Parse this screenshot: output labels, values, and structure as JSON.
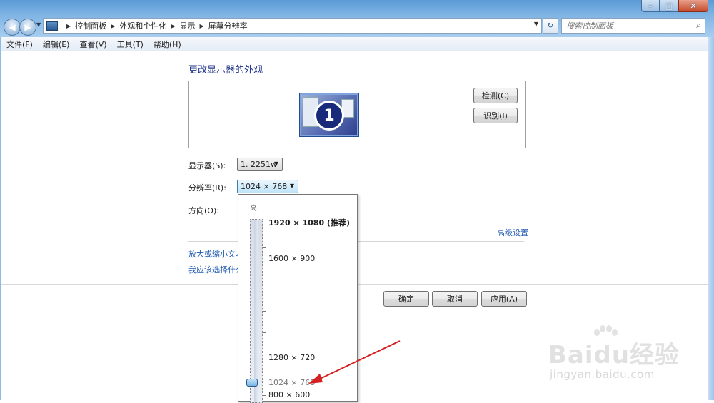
{
  "window": {
    "controls": {
      "minimize": "–",
      "maximize": "□",
      "close": "✕"
    }
  },
  "nav": {
    "back_icon": "arrow-left-icon",
    "forward_icon": "arrow-right-icon"
  },
  "address": {
    "crumbs": [
      "控制面板",
      "外观和个性化",
      "显示",
      "屏幕分辨率"
    ]
  },
  "search": {
    "placeholder": "搜索控制面板"
  },
  "menu": [
    "文件(F)",
    "编辑(E)",
    "查看(V)",
    "工具(T)",
    "帮助(H)"
  ],
  "main": {
    "title": "更改显示器的外观",
    "monitor_number": "1",
    "detect_label": "检测(C)",
    "identify_label": "识别(I)",
    "display_label": "显示器(S):",
    "display_value": "1. 2251w",
    "resolution_label": "分辨率(R):",
    "resolution_value": "1024 × 768",
    "orientation_label": "方向(O):",
    "advanced_link": "高级设置",
    "link_text_size": "放大或缩小文本",
    "link_what_to_choose": "我应该选择什么"
  },
  "dialog_buttons": {
    "ok": "确定",
    "cancel": "取消",
    "apply": "应用(A)"
  },
  "resolution_popup": {
    "high_label": "高",
    "options": [
      "1920 × 1080 (推荐)",
      "1600 × 900",
      "1280 × 720",
      "1024 × 768",
      "800 × 600"
    ],
    "selected": "1024 × 768"
  },
  "watermark": {
    "logo": "Baidu经验",
    "url": "jingyan.baidu.com"
  },
  "colors": {
    "link": "#1e59b0",
    "title": "#1e3287",
    "annotation_arrow": "#d42020"
  }
}
